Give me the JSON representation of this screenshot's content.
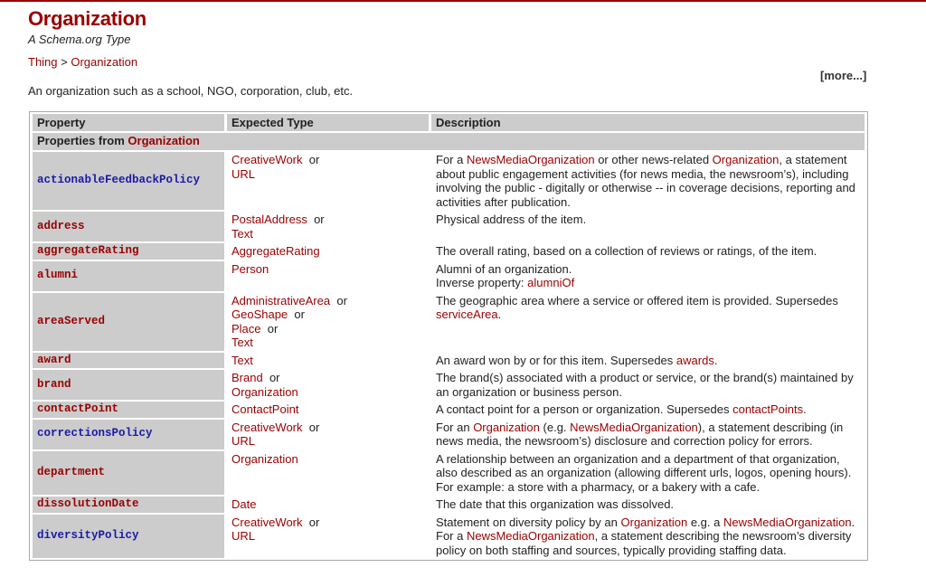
{
  "header": {
    "title": "Organization",
    "subtitle": "A Schema.org Type",
    "breadcrumb": [
      "Thing",
      "Organization"
    ],
    "breadcrumb_separator": " > ",
    "more_link": "[more...]",
    "intro": "An organization such as a school, NGO, corporation, club, etc."
  },
  "colors": {
    "accent": "#990000",
    "pending_property": "#1a1aa6",
    "cell_gray": "#cccccc"
  },
  "table": {
    "columns": [
      "Property",
      "Expected Type",
      "Description"
    ],
    "section_label_prefix": "Properties from ",
    "section_label_link": "Organization",
    "or_word": "or",
    "rows": [
      {
        "property": "actionableFeedbackPolicy",
        "pending": true,
        "types": [
          "CreativeWork",
          "URL"
        ],
        "description": [
          [
            "text",
            "For a "
          ],
          [
            "link",
            "NewsMediaOrganization"
          ],
          [
            "text",
            " or other news-related "
          ],
          [
            "link",
            "Organization"
          ],
          [
            "text",
            ", a statement about public engagement activities (for news media, the newsroom’s), including involving the public - digitally or otherwise -- in coverage decisions, reporting and activities after publication."
          ]
        ]
      },
      {
        "property": "address",
        "pending": false,
        "types": [
          "PostalAddress",
          "Text"
        ],
        "description": [
          [
            "text",
            "Physical address of the item."
          ]
        ]
      },
      {
        "property": "aggregateRating",
        "pending": false,
        "types": [
          "AggregateRating"
        ],
        "description": [
          [
            "text",
            "The overall rating, based on a collection of reviews or ratings, of the item."
          ]
        ]
      },
      {
        "property": "alumni",
        "pending": false,
        "types": [
          "Person"
        ],
        "description": [
          [
            "text",
            "Alumni of an organization."
          ],
          [
            "br",
            ""
          ],
          [
            "text",
            "Inverse property: "
          ],
          [
            "link",
            "alumniOf"
          ]
        ]
      },
      {
        "property": "areaServed",
        "pending": false,
        "types": [
          "AdministrativeArea",
          "GeoShape",
          "Place",
          "Text"
        ],
        "description": [
          [
            "text",
            "The geographic area where a service or offered item is provided. Supersedes "
          ],
          [
            "link",
            "serviceArea"
          ],
          [
            "text",
            "."
          ]
        ]
      },
      {
        "property": "award",
        "pending": false,
        "types": [
          "Text"
        ],
        "description": [
          [
            "text",
            "An award won by or for this item. Supersedes "
          ],
          [
            "link",
            "awards"
          ],
          [
            "text",
            "."
          ]
        ]
      },
      {
        "property": "brand",
        "pending": false,
        "types": [
          "Brand",
          "Organization"
        ],
        "description": [
          [
            "text",
            "The brand(s) associated with a product or service, or the brand(s) maintained by an organization or business person."
          ]
        ]
      },
      {
        "property": "contactPoint",
        "pending": false,
        "types": [
          "ContactPoint"
        ],
        "description": [
          [
            "text",
            "A contact point for a person or organization. Supersedes "
          ],
          [
            "link",
            "contactPoints"
          ],
          [
            "text",
            "."
          ]
        ]
      },
      {
        "property": "correctionsPolicy",
        "pending": true,
        "types": [
          "CreativeWork",
          "URL"
        ],
        "description": [
          [
            "text",
            "For an "
          ],
          [
            "link",
            "Organization"
          ],
          [
            "text",
            " (e.g. "
          ],
          [
            "link",
            "NewsMediaOrganization"
          ],
          [
            "text",
            "), a statement describing (in news media, the newsroom’s) disclosure and correction policy for errors."
          ]
        ]
      },
      {
        "property": "department",
        "pending": false,
        "types": [
          "Organization"
        ],
        "description": [
          [
            "text",
            "A relationship between an organization and a department of that organization, also described as an organization (allowing different urls, logos, opening hours). For example: a store with a pharmacy, or a bakery with a cafe."
          ]
        ]
      },
      {
        "property": "dissolutionDate",
        "pending": false,
        "types": [
          "Date"
        ],
        "description": [
          [
            "text",
            "The date that this organization was dissolved."
          ]
        ]
      },
      {
        "property": "diversityPolicy",
        "pending": true,
        "types": [
          "CreativeWork",
          "URL"
        ],
        "description": [
          [
            "text",
            "Statement on diversity policy by an "
          ],
          [
            "link",
            "Organization"
          ],
          [
            "text",
            " e.g. a "
          ],
          [
            "link",
            "NewsMediaOrganization"
          ],
          [
            "text",
            ". For a "
          ],
          [
            "link",
            "NewsMediaOrganization"
          ],
          [
            "text",
            ", a statement describing the newsroom’s diversity policy on both staffing and sources, typically providing staffing data."
          ]
        ]
      }
    ]
  }
}
